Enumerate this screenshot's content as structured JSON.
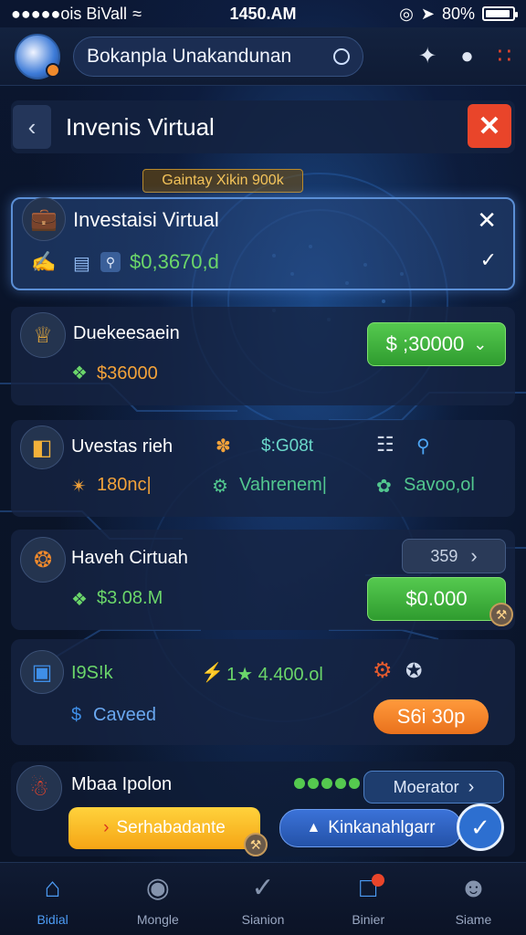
{
  "status_bar": {
    "carrier": "●●●●●ois BiVall",
    "time": "1450.AM",
    "battery": "80%"
  },
  "top_bar": {
    "search_text": "Bokanpla Unakandunan"
  },
  "header": {
    "title": "Invenis Virtual"
  },
  "section_label": "Gaintay Xikin 900k",
  "cards": {
    "virtual": {
      "title": "Investaisi Virtual",
      "amount": "$0,3670,d"
    },
    "duekee": {
      "title": "Duekeesaein",
      "amount": "$36000",
      "button": "$ ;30000"
    },
    "uvestas": {
      "title": "Uvestas rieh",
      "price": "$:G08t",
      "stat_1": "180nc|",
      "stat_2": "Vahrenem|",
      "stat_3": "Savoo,ol"
    },
    "haveh": {
      "title": "Haveh Cirtuah",
      "amount": "$3.08.M",
      "counter": "359",
      "button": "$0.000"
    },
    "stats_row": {
      "stat_1": "I9S!k",
      "stat_2": "1★ 4.400.ol",
      "link": "Caveed",
      "button": "S6i 30p"
    },
    "mbaa": {
      "title": "Mbaa Ipolon",
      "moderator": "Moerator",
      "btn_yellow": "Serhabadante",
      "btn_blue": "Kinkanahlgarr"
    }
  },
  "bottom_nav": [
    {
      "label": "Bidial",
      "icon": "home-icon",
      "active": true
    },
    {
      "label": "Mongle",
      "icon": "chevron-circle-icon",
      "active": false
    },
    {
      "label": "Sianion",
      "icon": "check-circle-icon",
      "active": false
    },
    {
      "label": "Binier",
      "icon": "message-icon",
      "active": false
    },
    {
      "label": "Siame",
      "icon": "profile-icon",
      "active": false
    }
  ],
  "colors": {
    "accent_blue": "#4d9cf5",
    "green": "#3fb63a",
    "orange": "#f08a2c",
    "danger": "#e9452a"
  }
}
